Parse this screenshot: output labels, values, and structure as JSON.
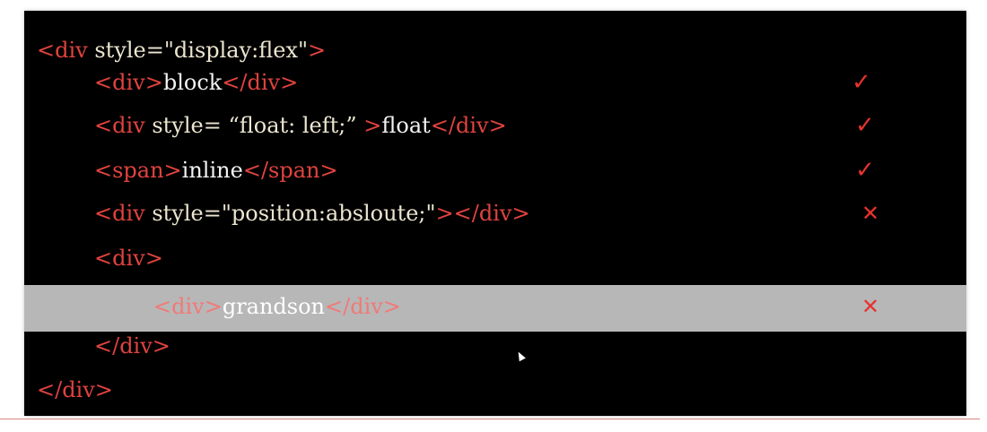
{
  "lines": [
    {
      "open": "<div",
      "attr": " style=",
      "value": "\"display:flex\"",
      "close": ">",
      "text": "",
      "end": "",
      "mark": ""
    },
    {
      "open": "<div>",
      "attr": "",
      "value": "",
      "close": "",
      "text": "block",
      "end": "</div>",
      "mark": "✓"
    },
    {
      "open": "<div",
      "attr": " style= ",
      "value": "“float: left;” ",
      "close": ">",
      "text": "float",
      "end": "</div>",
      "mark": "✓"
    },
    {
      "open": "<span>",
      "attr": "",
      "value": "",
      "close": "",
      "text": "inline",
      "end": "</span>",
      "mark": "✓"
    },
    {
      "open": "<div",
      "attr": " style=",
      "value": "\"position:absloute;\"",
      "close": ">",
      "text": "",
      "end": "</div>",
      "mark": "✕"
    },
    {
      "open": "<div>",
      "attr": "",
      "value": "",
      "close": "",
      "text": "",
      "end": "",
      "mark": ""
    },
    {
      "open": "<div>",
      "attr": "",
      "value": "",
      "close": "",
      "text": "grandson",
      "end": "</div>",
      "mark": "✕"
    },
    {
      "open": "</div>",
      "attr": "",
      "value": "",
      "close": "",
      "text": "",
      "end": "",
      "mark": ""
    },
    {
      "open": "</div>",
      "attr": "",
      "value": "",
      "close": "",
      "text": "",
      "end": "",
      "mark": ""
    }
  ],
  "icons": {
    "check": "check-mark-icon",
    "cross": "cross-mark-icon",
    "cursor": "mouse-cursor-icon"
  },
  "colors": {
    "panel_background": "#000000",
    "tag": "#e0433f",
    "text": "#f3f3f3",
    "highlight_band": "#b7b7b7",
    "marks": "#e6332f"
  }
}
